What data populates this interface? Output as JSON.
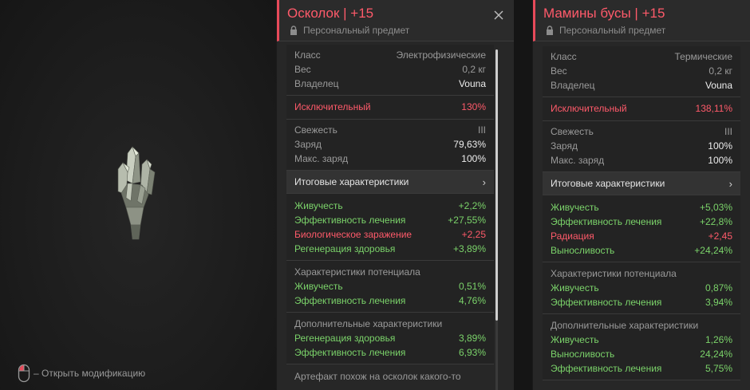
{
  "preview": {
    "hint_text": "– Открыть модификацию"
  },
  "item1": {
    "title": "Осколок | +15",
    "subtitle": "Персональный предмет",
    "info": [
      {
        "label": "Класс",
        "value": "Электрофизические"
      },
      {
        "label": "Вес",
        "value": "0,2 кг"
      },
      {
        "label": "Владелец",
        "value": "Vouna"
      }
    ],
    "rarity": {
      "label": "Исключительный",
      "value": "130%"
    },
    "state": [
      {
        "label": "Свежесть",
        "value": "III"
      },
      {
        "label": "Заряд",
        "value": "79,63%"
      },
      {
        "label": "Макс. заряд",
        "value": "100%"
      }
    ],
    "summary_label": "Итоговые характеристики",
    "totals": [
      {
        "label": "Живучесть",
        "value": "+2,2%",
        "tone": "green"
      },
      {
        "label": "Эффективность лечения",
        "value": "+27,55%",
        "tone": "green"
      },
      {
        "label": "Биологическое заражение",
        "value": "+2,25",
        "tone": "bad"
      },
      {
        "label": "Регенерация здоровья",
        "value": "+3,89%",
        "tone": "green"
      }
    ],
    "potential_head": "Характеристики потенциала",
    "potential": [
      {
        "label": "Живучесть",
        "value": "0,51%"
      },
      {
        "label": "Эффективность лечения",
        "value": "4,76%"
      }
    ],
    "extra_head": "Дополнительные характеристики",
    "extra": [
      {
        "label": "Регенерация здоровья",
        "value": "3,89%"
      },
      {
        "label": "Эффективность лечения",
        "value": "6,93%"
      }
    ],
    "description": "Артефакт похож на осколок какого-то"
  },
  "item2": {
    "title": "Мамины бусы | +15",
    "subtitle": "Персональный предмет",
    "info": [
      {
        "label": "Класс",
        "value": "Термические"
      },
      {
        "label": "Вес",
        "value": "0,2 кг"
      },
      {
        "label": "Владелец",
        "value": "Vouna"
      }
    ],
    "rarity": {
      "label": "Исключительный",
      "value": "138,11%"
    },
    "state": [
      {
        "label": "Свежесть",
        "value": "III"
      },
      {
        "label": "Заряд",
        "value": "100%"
      },
      {
        "label": "Макс. заряд",
        "value": "100%"
      }
    ],
    "summary_label": "Итоговые характеристики",
    "totals": [
      {
        "label": "Живучесть",
        "value": "+5,03%",
        "tone": "green"
      },
      {
        "label": "Эффективность лечения",
        "value": "+22,8%",
        "tone": "green"
      },
      {
        "label": "Радиация",
        "value": "+2,45",
        "tone": "bad"
      },
      {
        "label": "Выносливость",
        "value": "+24,24%",
        "tone": "green"
      }
    ],
    "potential_head": "Характеристики потенциала",
    "potential": [
      {
        "label": "Живучесть",
        "value": "0,87%"
      },
      {
        "label": "Эффективность лечения",
        "value": "3,94%"
      }
    ],
    "extra_head": "Дополнительные характеристики",
    "extra": [
      {
        "label": "Живучесть",
        "value": "1,26%"
      },
      {
        "label": "Выносливость",
        "value": "24,24%"
      },
      {
        "label": "Эффективность лечения",
        "value": "5,75%"
      }
    ]
  },
  "colors": {
    "accent": "#ff5a6a",
    "positive": "#7bd36a",
    "negative": "#ff5a6a"
  }
}
